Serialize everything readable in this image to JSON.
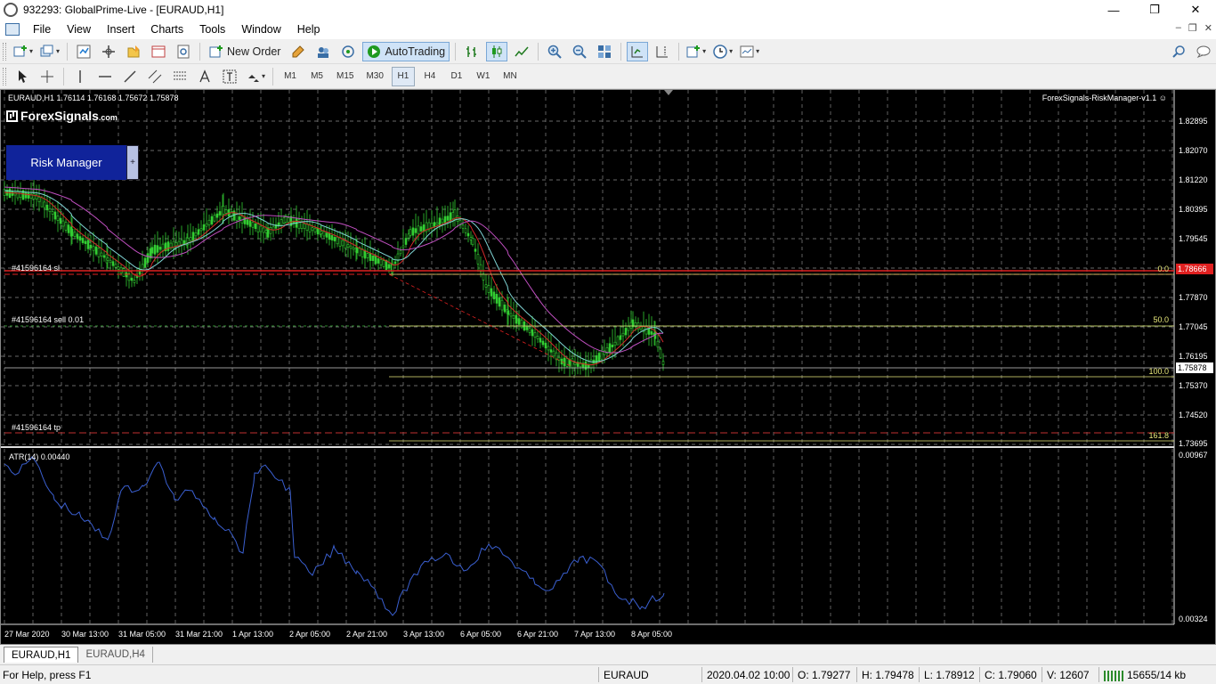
{
  "window": {
    "title": "932293: GlobalPrime-Live - [EURAUD,H1]",
    "minimize": "—",
    "maximize": "❐",
    "close": "✕"
  },
  "menu": {
    "items": [
      "File",
      "View",
      "Insert",
      "Charts",
      "Tools",
      "Window",
      "Help"
    ]
  },
  "toolbar": {
    "new_order": "New Order",
    "auto_trading": "AutoTrading"
  },
  "timeframes": [
    "M1",
    "M5",
    "M15",
    "M30",
    "H1",
    "H4",
    "D1",
    "W1",
    "MN"
  ],
  "active_timeframe": "H1",
  "chart": {
    "symbol_info": "EURAUD,H1  1.76114 1.76168 1.75672 1.75878",
    "ea_name": "ForexSignals-RiskManager-v1.1 ☺",
    "logo": "ForexSignals",
    "logo_suffix": ".com",
    "risk_panel_label": "Risk Manager",
    "risk_panel_toggle": "+",
    "order_levels": {
      "sl": "#41596164 sl",
      "sell": "#41596164 sell 0.01",
      "tp": "#41596164 tp"
    },
    "fib_levels": {
      "f0": "0.0",
      "f50": "50.0",
      "f100": "100.0",
      "f161": "161.8"
    },
    "price_axis": [
      "1.82895",
      "1.82070",
      "1.81220",
      "1.80395",
      "1.79545",
      "1.77870",
      "1.77045",
      "1.76195",
      "1.75370",
      "1.74520",
      "1.73695"
    ],
    "sl_price_box": "1.78666",
    "current_price_box": "1.75878",
    "atr_title": "ATR(14) 0.00440",
    "atr_axis": [
      "0.00967",
      "0.00324"
    ],
    "date_axis": [
      "27 Mar 2020",
      "30 Mar 13:00",
      "31 Mar 05:00",
      "31 Mar 21:00",
      "1 Apr 13:00",
      "2 Apr 05:00",
      "2 Apr 21:00",
      "3 Apr 13:00",
      "6 Apr 05:00",
      "6 Apr 21:00",
      "7 Apr 13:00",
      "8 Apr 05:00"
    ],
    "colors": {
      "background": "#000000",
      "grid": "#8a8a8a",
      "candle": "#32cd32",
      "ma_fast": "#d42a2a",
      "ma_mid": "#7fd4d4",
      "ma_slow": "#c04fc0",
      "atr": "#3a5fd0",
      "sl_line": "#e02020",
      "tp_line": "#c03030",
      "fib": "#e8e87a"
    }
  },
  "tabs": [
    "EURAUD,H1",
    "EURAUD,H4"
  ],
  "status": {
    "help": "For Help, press F1",
    "symbol": "EURAUD",
    "datetime": "2020.04.02 10:00",
    "open": "O: 1.79277",
    "high": "H: 1.79478",
    "low": "L: 1.78912",
    "close": "C: 1.79060",
    "volume": "V: 12607",
    "connection": "15655/14 kb"
  }
}
